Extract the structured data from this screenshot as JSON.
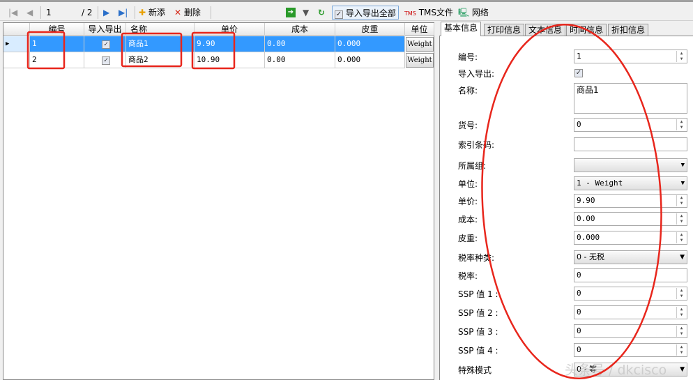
{
  "toolbar": {
    "page_current": "1",
    "page_total": "/ 2",
    "add_label": "新添",
    "delete_label": "删除",
    "import_export_all_label": "导入导出全部",
    "tms_label": "TMS文件",
    "network_label": "网络"
  },
  "grid": {
    "columns": [
      "编号",
      "导入导出",
      "名称",
      "单价",
      "成本",
      "皮重",
      "单位"
    ],
    "rows": [
      {
        "id": "1",
        "import_export": true,
        "name": "商品1",
        "price": "9.90",
        "cost": "0.00",
        "tare": "0.000",
        "unit": "Weight"
      },
      {
        "id": "2",
        "import_export": true,
        "name": "商品2",
        "price": "10.90",
        "cost": "0.00",
        "tare": "0.000",
        "unit": "Weight"
      }
    ]
  },
  "tabs": [
    "基本信息",
    "打印信息",
    "文本信息",
    "时间信息",
    "折扣信息"
  ],
  "form": {
    "id": {
      "label": "编号:",
      "value": "1"
    },
    "import_export": {
      "label": "导入导出:"
    },
    "name": {
      "label": "名称:",
      "value": "商品1"
    },
    "item_no": {
      "label": "货号:",
      "value": "0"
    },
    "barcode": {
      "label": "索引条码:",
      "value": ""
    },
    "group": {
      "label": "所属组:",
      "value": ""
    },
    "unit": {
      "label": "单位:",
      "value": "1 - Weight"
    },
    "price": {
      "label": "单价:",
      "value": "9.90"
    },
    "cost": {
      "label": "成本:",
      "value": "0.00"
    },
    "tare": {
      "label": "皮重:",
      "value": "0.000"
    },
    "tax_type": {
      "label": "税率种类:",
      "value": "0 - 无税"
    },
    "tax_rate": {
      "label": "税率:",
      "value": "0"
    },
    "ssp1": {
      "label": "SSP 值 1 :",
      "value": "0"
    },
    "ssp2": {
      "label": "SSP 值 2 :",
      "value": "0"
    },
    "ssp3": {
      "label": "SSP 值 3 :",
      "value": "0"
    },
    "ssp4": {
      "label": "SSP 值 4 :",
      "value": "0"
    },
    "special_mode": {
      "label": "特殊模式",
      "value": "0 - 等"
    }
  },
  "watermark": "头条号 / dkcisco",
  "colors": {
    "selection": "#3399ff",
    "annotation": "#e8261c"
  }
}
